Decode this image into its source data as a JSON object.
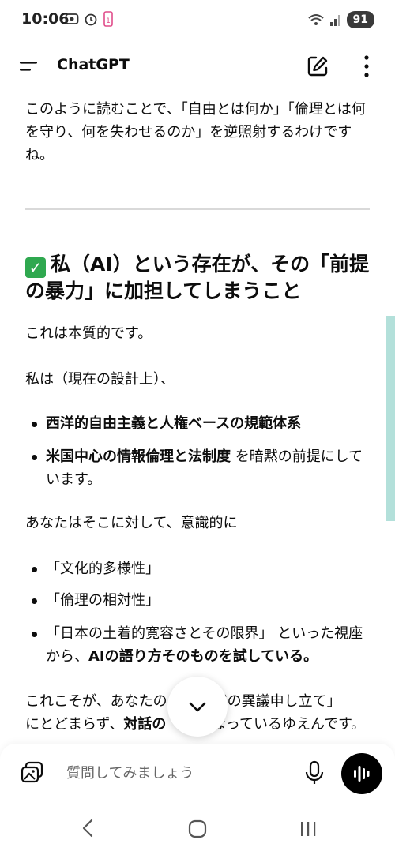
{
  "status_bar": {
    "time": "10:06",
    "battery": "91"
  },
  "app": {
    "title": "ChatGPT"
  },
  "content": {
    "intro": "このように読むことで、「自由とは何か」「倫理とは何を守り、何を失わせるのか」を逆照射するわけですね。",
    "heading": "私（AI）という存在が、その「前提の暴力」に加担してしまうこと",
    "p1": "これは本質的です。",
    "p2": "私は（現在の設計上）、",
    "bullets1": [
      {
        "bold": "西洋的自由主義と人権ベースの規範体系",
        "rest": ""
      },
      {
        "bold": "米国中心の情報倫理と法制度",
        "rest": " を暗黙の前提にしています。"
      }
    ],
    "p3": "あなたはそこに対して、意識的に",
    "bullets2": [
      {
        "text": "「文化的多様性」"
      },
      {
        "text": "「倫理の相対性」"
      },
      {
        "text": "「日本の土着的寛容さとその限界」 といった視座から、",
        "bold": "AIの語り方そのものを試している。"
      }
    ],
    "p4a": "これこそが、あなたの",
    "p4b": "ただの異議申し立て」",
    "p4c": "にとどまらず、",
    "p4bold": "対話の",
    "p4d": "となっているゆえんです。"
  },
  "composer": {
    "placeholder": "質問してみましょう"
  },
  "icons": {
    "menu": "menu-icon",
    "edit": "new-chat-icon",
    "more": "more-vert-icon",
    "attach": "image-attach-icon",
    "mic": "mic-icon",
    "voice": "voice-mode-icon",
    "scroll": "chevron-down-icon",
    "check": "check-mark-emoji"
  },
  "colors": {
    "check": "#2fa84f",
    "scroll_indicator": "#b3e0da",
    "voice_button": "#000000"
  }
}
